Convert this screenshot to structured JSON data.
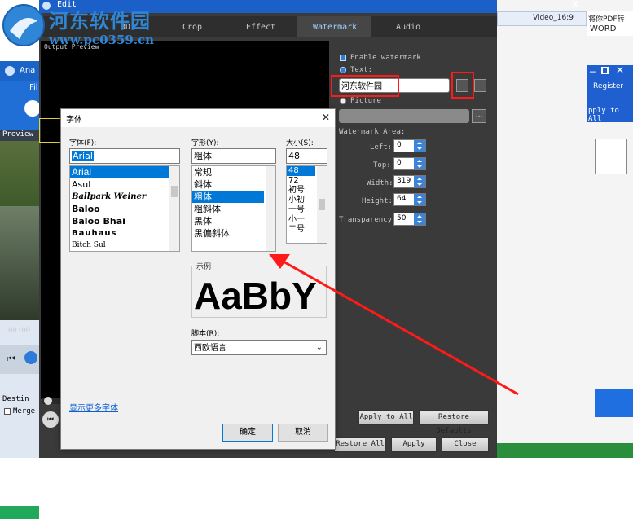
{
  "watermark_logo": {
    "line1": "河东软件园",
    "line2": "www.pc0359.cn"
  },
  "left_app": {
    "title": "Ana",
    "file_menu": "Fil",
    "preview_label": "Preview",
    "time": "00:00",
    "destination": "Destin",
    "merge": "Merge"
  },
  "right_app": {
    "tab_text": "Video_16:9",
    "pdf_text": "将你PDF转",
    "word_text": "WORD",
    "register": "Register",
    "apply_all": "pply to All"
  },
  "edit_window": {
    "title": "Edit",
    "tabs": [
      "3D",
      "Crop",
      "Effect",
      "Watermark",
      "Audio"
    ],
    "active_tab": "Watermark",
    "output_preview": "Output Preview",
    "enable_watermark": "Enable watermark",
    "text_option": "Text:",
    "text_value": "河东软件园",
    "picture_option": "Picture",
    "browse_label": "...",
    "area_label": "Watermark Area:",
    "fields": [
      {
        "label": "Left:",
        "value": "0"
      },
      {
        "label": "Top:",
        "value": "0"
      },
      {
        "label": "Width:",
        "value": "319"
      },
      {
        "label": "Height:",
        "value": "64"
      },
      {
        "label": "Transparency:",
        "value": "50"
      }
    ],
    "apply_to_all": "Apply to All",
    "restore_defaults": "Restore Defaults",
    "restore_all": "Restore All",
    "apply": "Apply",
    "close": "Close"
  },
  "font_dialog": {
    "title": "字体",
    "font_label": "字体(F):",
    "font_value": "Arial",
    "fonts": [
      "Arial",
      "Asul",
      "Ballpark Weiner",
      "Baloo",
      "Baloo Bhai",
      "Bauhaus",
      "Bitch Sul"
    ],
    "style_label": "字形(Y):",
    "style_value": "粗体",
    "styles": [
      "常规",
      "斜体",
      "粗体",
      "粗斜体",
      "黑体",
      "黑偏斜体"
    ],
    "size_label": "大小(S):",
    "size_value": "48",
    "sizes": [
      "48",
      "72",
      "初号",
      "小初",
      "一号",
      "小一",
      "二号"
    ],
    "sample_label": "示例",
    "sample_text": "AaBbY",
    "script_label": "脚本(R):",
    "script_value": "西欧语言",
    "more_fonts": "显示更多字体",
    "ok": "确定",
    "cancel": "取消"
  },
  "colors": {
    "highlight_red": "#ff1a1a",
    "dark_panel": "#3a3a3a",
    "accent_blue": "#0078d7"
  }
}
